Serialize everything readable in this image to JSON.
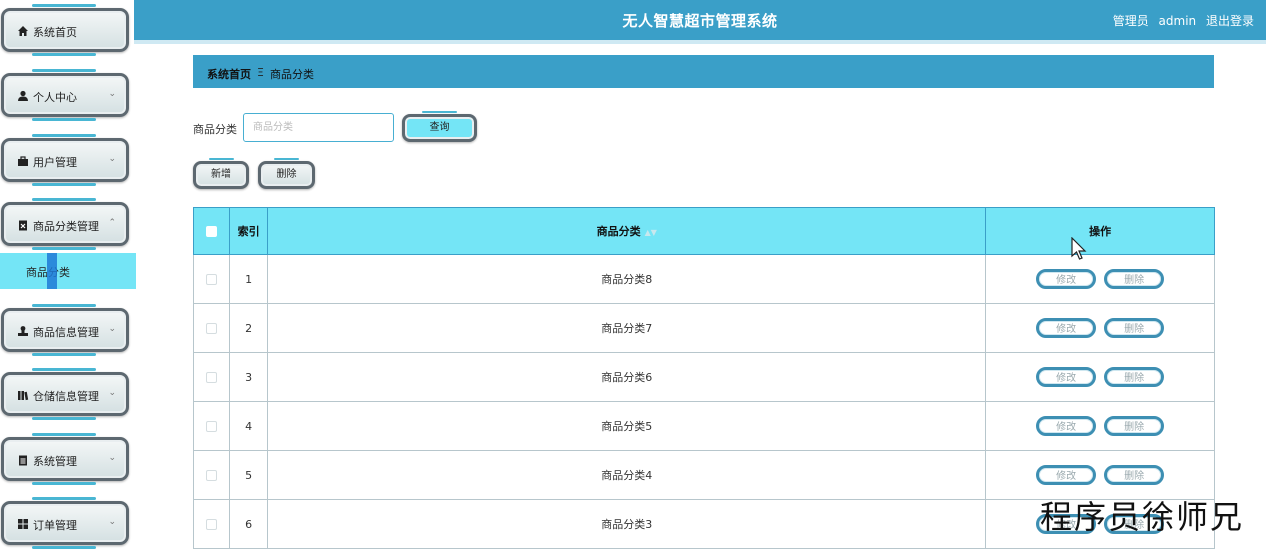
{
  "header": {
    "title": "无人智慧超市管理系统",
    "user_role": "管理员",
    "username": "admin",
    "logout_label": "退出登录"
  },
  "sidebar": {
    "items": [
      {
        "label": "系统首页",
        "icon": "home-icon",
        "expandable": false
      },
      {
        "label": "个人中心",
        "icon": "user-icon",
        "expandable": true
      },
      {
        "label": "用户管理",
        "icon": "briefcase-icon",
        "expandable": true
      },
      {
        "label": "商品分类管理",
        "icon": "clipboard-icon",
        "expandable": true,
        "expanded": true
      },
      {
        "label": "商品信息管理",
        "icon": "person-stamp-icon",
        "expandable": true
      },
      {
        "label": "仓储信息管理",
        "icon": "library-icon",
        "expandable": true
      },
      {
        "label": "系统管理",
        "icon": "clipboard-list-icon",
        "expandable": true
      },
      {
        "label": "订单管理",
        "icon": "grid-icon",
        "expandable": true
      }
    ],
    "sub_item": {
      "label": "商品分类"
    }
  },
  "breadcrumb": {
    "home": "系统首页",
    "separator": "Ξ",
    "current": "商品分类"
  },
  "search": {
    "label": "商品分类",
    "placeholder": "商品分类",
    "query_button": "查询"
  },
  "actions": {
    "add_label": "新增",
    "delete_label": "删除"
  },
  "table": {
    "headers": {
      "index": "索引",
      "name": "商品分类",
      "operation": "操作"
    },
    "edit_label": "修改",
    "delete_label": "删除",
    "rows": [
      {
        "index": "1",
        "name": "商品分类8"
      },
      {
        "index": "2",
        "name": "商品分类7"
      },
      {
        "index": "3",
        "name": "商品分类6"
      },
      {
        "index": "4",
        "name": "商品分类5"
      },
      {
        "index": "5",
        "name": "商品分类4"
      },
      {
        "index": "6",
        "name": "商品分类3"
      }
    ]
  },
  "watermark": "程序员徐师兄",
  "colors": {
    "primary": "#3a9fc8",
    "highlight": "#74e5f6",
    "nav_border": "#5d6870"
  }
}
